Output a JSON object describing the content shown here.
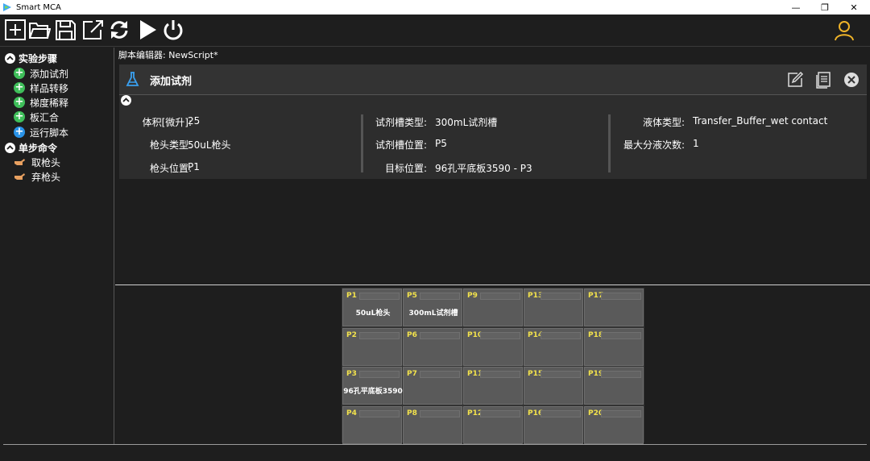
{
  "window": {
    "title": "Smart MCA",
    "minimize": "—",
    "restore": "❐",
    "close": "✕"
  },
  "tree": {
    "categories": [
      {
        "label": "实验步骤",
        "items": [
          "添加试剂",
          "样品转移",
          "梯度稀释",
          "板汇合",
          "运行脚本"
        ]
      },
      {
        "label": "单步命令",
        "items": [
          "取枪头",
          "弃枪头"
        ]
      }
    ]
  },
  "editor": {
    "label": "脚本编辑器:  NewScript*",
    "step_title": "添加试剂",
    "props": [
      {
        "key": "体积[微升]:",
        "value": "25"
      },
      {
        "key": "枪头类型:",
        "value": "50uL枪头"
      },
      {
        "key": "枪头位置:",
        "value": "P1"
      },
      {
        "key": "试剂槽类型:",
        "value": "300mL试剂槽"
      },
      {
        "key": "试剂槽位置:",
        "value": "P5"
      },
      {
        "key": "目标位置:",
        "value": "96孔平底板3590 - P3"
      },
      {
        "key": "液体类型:",
        "value": "Transfer_Buffer_wet contact"
      },
      {
        "key": "最大分液次数:",
        "value": "1"
      }
    ]
  },
  "deck": {
    "slots": [
      {
        "id": "P1",
        "content": "50uL枪头"
      },
      {
        "id": "P5",
        "content": "300mL试剂槽"
      },
      {
        "id": "P9",
        "content": ""
      },
      {
        "id": "P13",
        "content": ""
      },
      {
        "id": "P17",
        "content": ""
      },
      {
        "id": "P2",
        "content": ""
      },
      {
        "id": "P6",
        "content": ""
      },
      {
        "id": "P10",
        "content": ""
      },
      {
        "id": "P14",
        "content": ""
      },
      {
        "id": "P18",
        "content": ""
      },
      {
        "id": "P3",
        "content": "96孔平底板3590"
      },
      {
        "id": "P7",
        "content": ""
      },
      {
        "id": "P11",
        "content": ""
      },
      {
        "id": "P15",
        "content": ""
      },
      {
        "id": "P19",
        "content": ""
      },
      {
        "id": "P4",
        "content": ""
      },
      {
        "id": "P8",
        "content": ""
      },
      {
        "id": "P12",
        "content": ""
      },
      {
        "id": "P16",
        "content": ""
      },
      {
        "id": "P20",
        "content": ""
      }
    ]
  },
  "colors": {
    "accent_user": "#f0b429",
    "slot_label": "#f2e24c",
    "flask": "#3aa0f0"
  }
}
